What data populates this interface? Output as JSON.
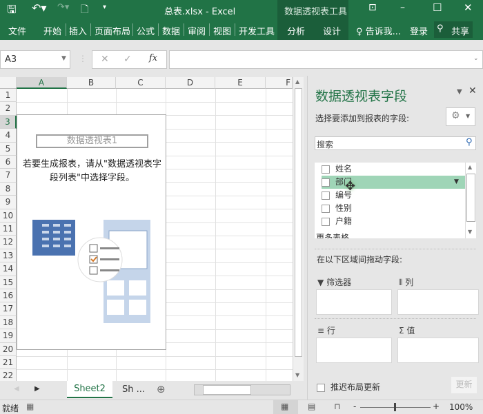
{
  "title_bar": {
    "filename": "总表.xlsx - Excel",
    "context_group": "数据透视表工具",
    "icons": [
      "save-icon",
      "undo-icon",
      "redo-icon",
      "new-file-icon",
      "customize-icon",
      "ribbon-display-icon",
      "minimize-icon",
      "maximize-icon",
      "close-icon"
    ]
  },
  "ribbon": {
    "tabs": [
      "文件",
      "开始",
      "插入",
      "页面布局",
      "公式",
      "数据",
      "审阅",
      "视图",
      "开发工具",
      "分析",
      "设计"
    ],
    "tell_me": "告诉我...",
    "login": "登录",
    "share": "共享"
  },
  "formula_bar": {
    "name_box": "A3",
    "formula": "",
    "fx": "fx"
  },
  "grid": {
    "columns": [
      "A",
      "B",
      "C",
      "D",
      "E",
      "F"
    ],
    "rows": [
      "1",
      "2",
      "3",
      "4",
      "5",
      "6",
      "7",
      "8",
      "9",
      "10",
      "11",
      "12",
      "13",
      "14",
      "15",
      "16",
      "17",
      "18",
      "19",
      "20",
      "21",
      "22"
    ],
    "selected_cell": "A3"
  },
  "pivot_placeholder": {
    "title": "数据透视表1",
    "instruction": "若要生成报表，请从\"数据透视表字段列表\"中选择字段。"
  },
  "sheets": {
    "tabs": [
      "Sheet2",
      "Sh ..."
    ],
    "active": "Sheet2"
  },
  "panel": {
    "title": "数据透视表字段",
    "choose_label": "选择要添加到报表的字段:",
    "search_placeholder": "搜索",
    "fields": [
      "姓名",
      "部门",
      "编号",
      "性别",
      "户籍"
    ],
    "highlighted_field": "部门",
    "more_tables": "更多表格",
    "drag_label": "在以下区域间拖动字段:",
    "areas": {
      "filter": "筛选器",
      "columns": "列",
      "rows": "行",
      "values": "值"
    },
    "defer_label": "推迟布局更新",
    "update_button": "更新"
  },
  "status": {
    "ready": "就绪",
    "zoom": "100%",
    "zoom_minus": "-",
    "zoom_plus": "+"
  },
  "colors": {
    "brand": "#217346",
    "highlight": "#9fd5b7"
  }
}
